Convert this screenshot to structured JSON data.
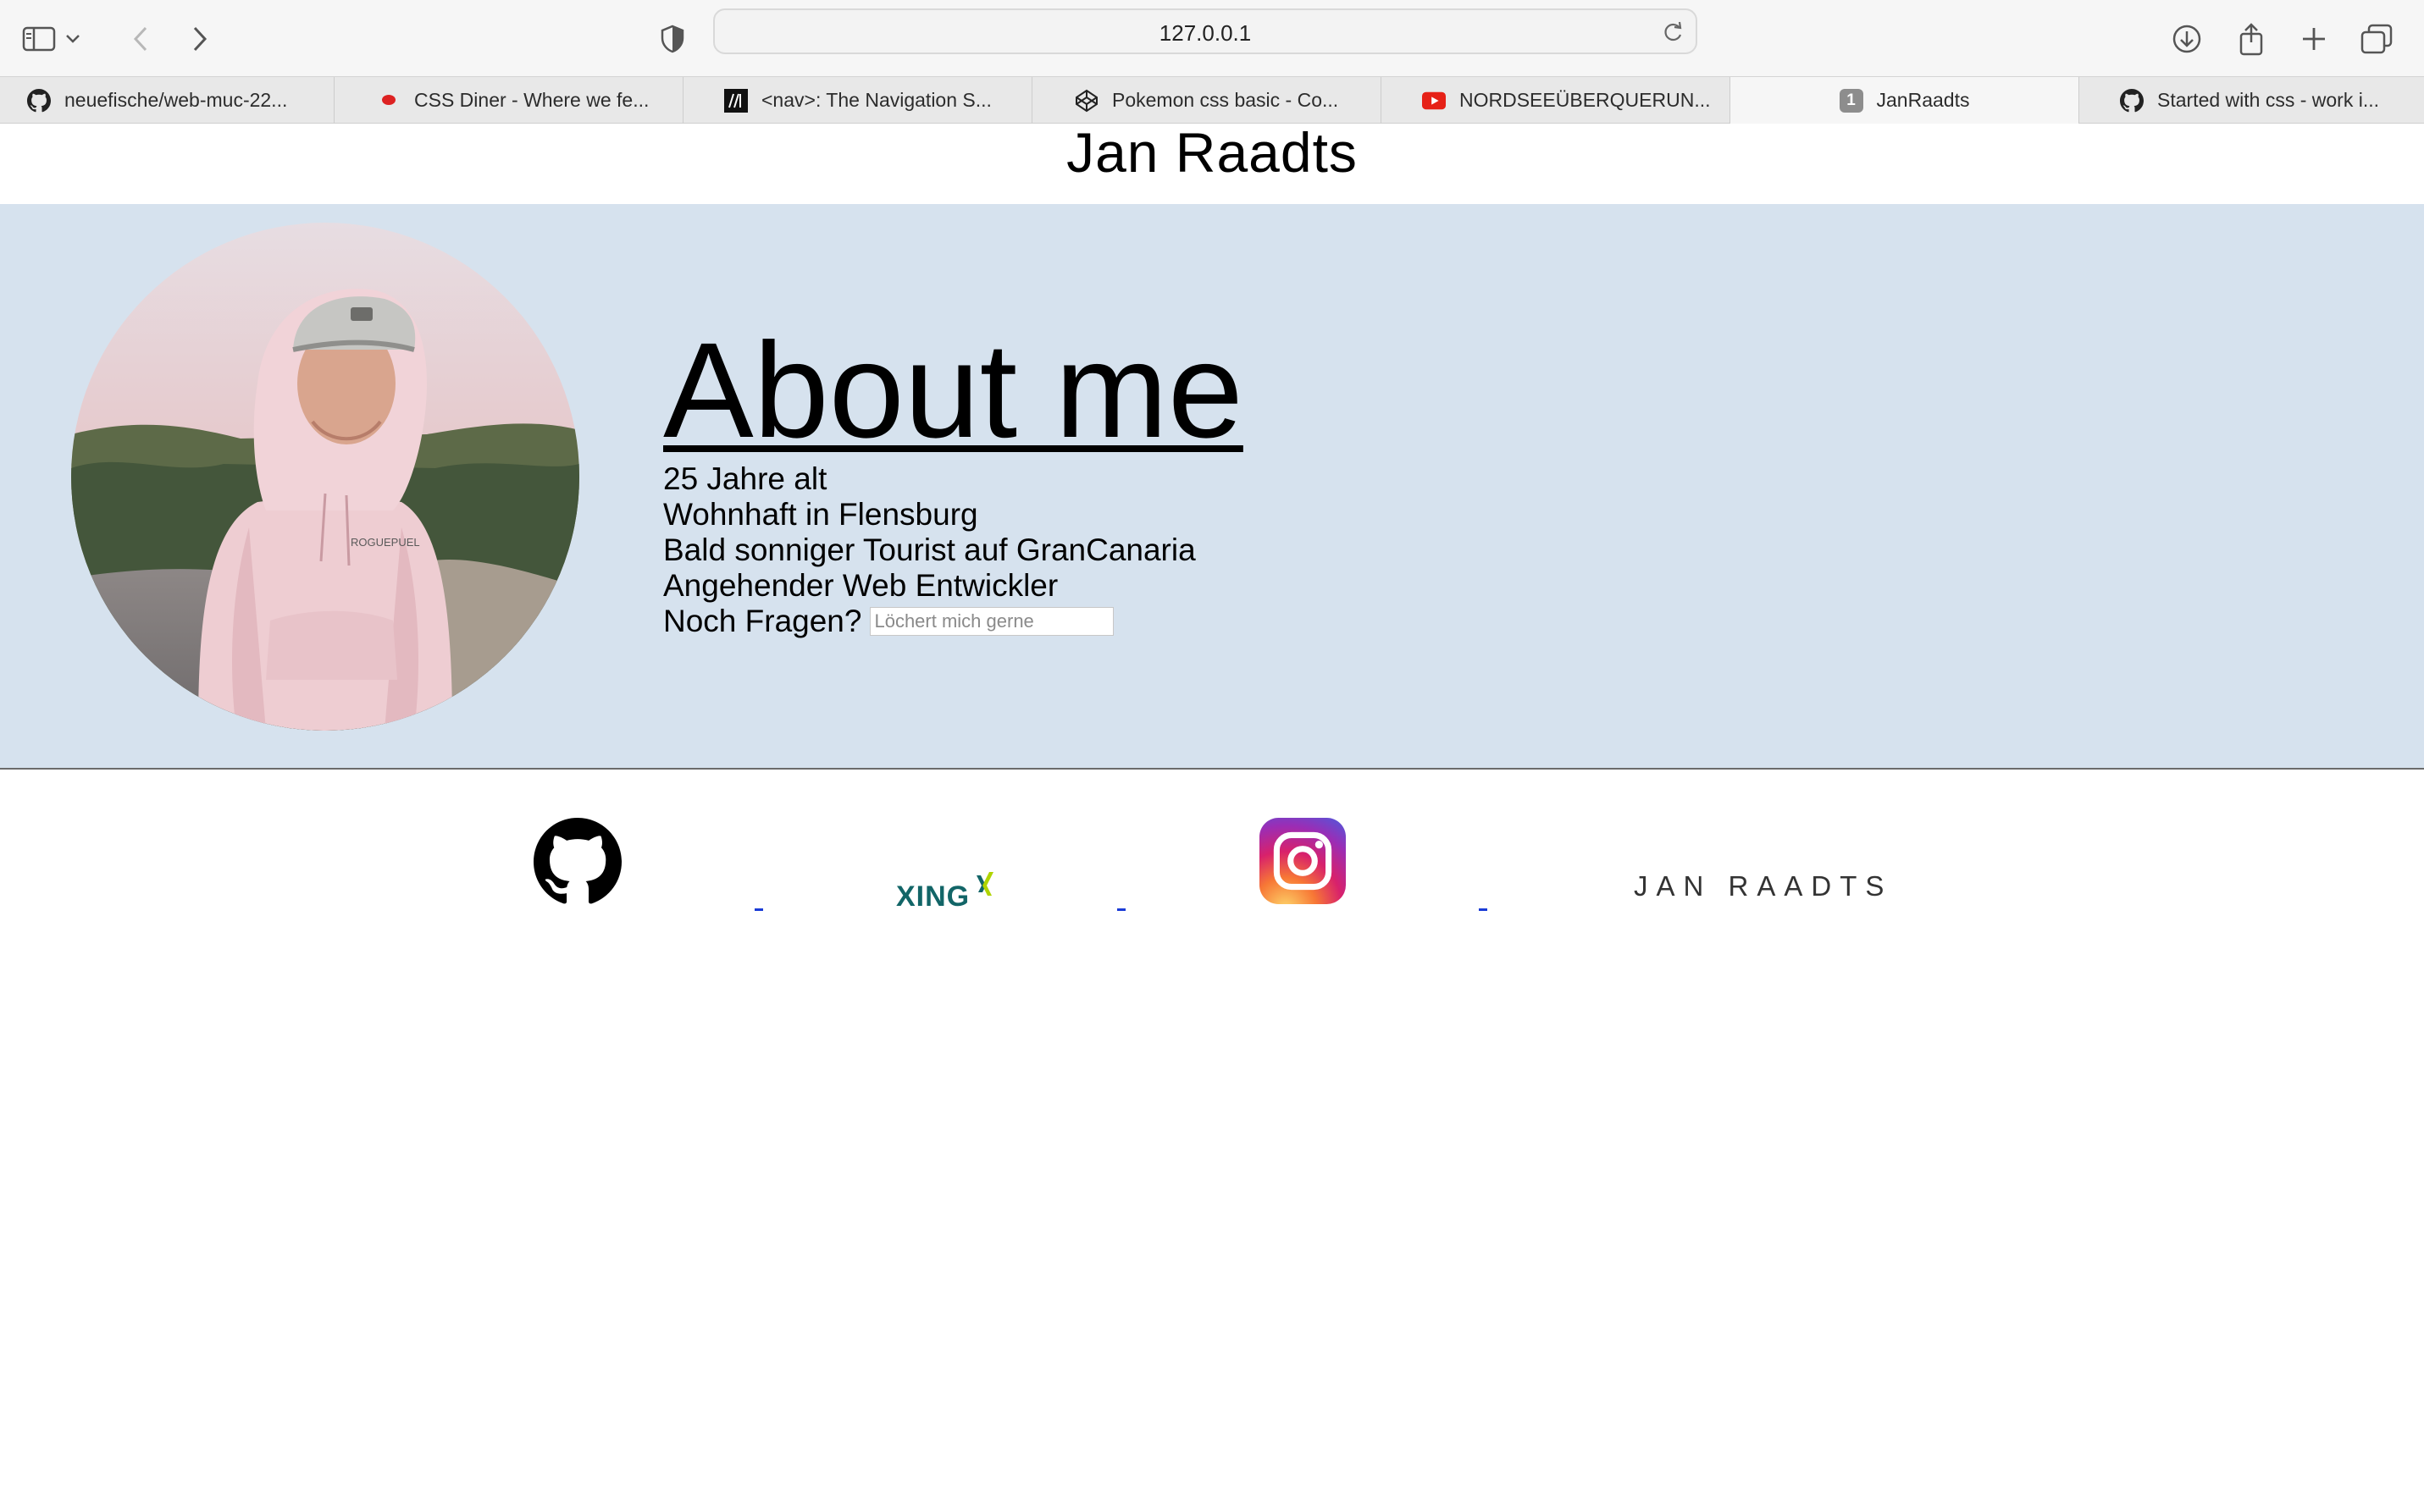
{
  "browser": {
    "url": "127.0.0.1",
    "tabs": [
      {
        "label": "neuefische/web-muc-22...",
        "icon": "github-icon"
      },
      {
        "label": "CSS Diner - Where we fe...",
        "icon": "css-diner-icon"
      },
      {
        "label": "<nav>: The Navigation S...",
        "icon": "mdn-icon"
      },
      {
        "label": "Pokemon css basic - Co...",
        "icon": "codepen-icon"
      },
      {
        "label": "NORDSEEÜBERQUERUN...",
        "icon": "youtube-icon"
      },
      {
        "label": "JanRaadts",
        "icon": "number-badge-icon",
        "badge": "1",
        "active": true
      },
      {
        "label": "Started with css - work i...",
        "icon": "github-icon"
      }
    ]
  },
  "page": {
    "title": "Jan Raadts",
    "about": {
      "heading": "About me",
      "facts": [
        "25 Jahre alt",
        "Wohnhaft in Flensburg",
        "Bald sonniger Tourist auf GranCanaria",
        "Angehender Web Entwickler"
      ],
      "question_label": "Noch Fragen?",
      "question_placeholder": "Löchert mich gerne"
    },
    "social": {
      "xing_label": "XING",
      "brand_label": "JAN RAADTS"
    }
  },
  "colors": {
    "hero_background": "#d6e2ee",
    "link_underline": "#1a3bd6",
    "xing_text": "#126567",
    "xing_x": "#b0d400"
  }
}
